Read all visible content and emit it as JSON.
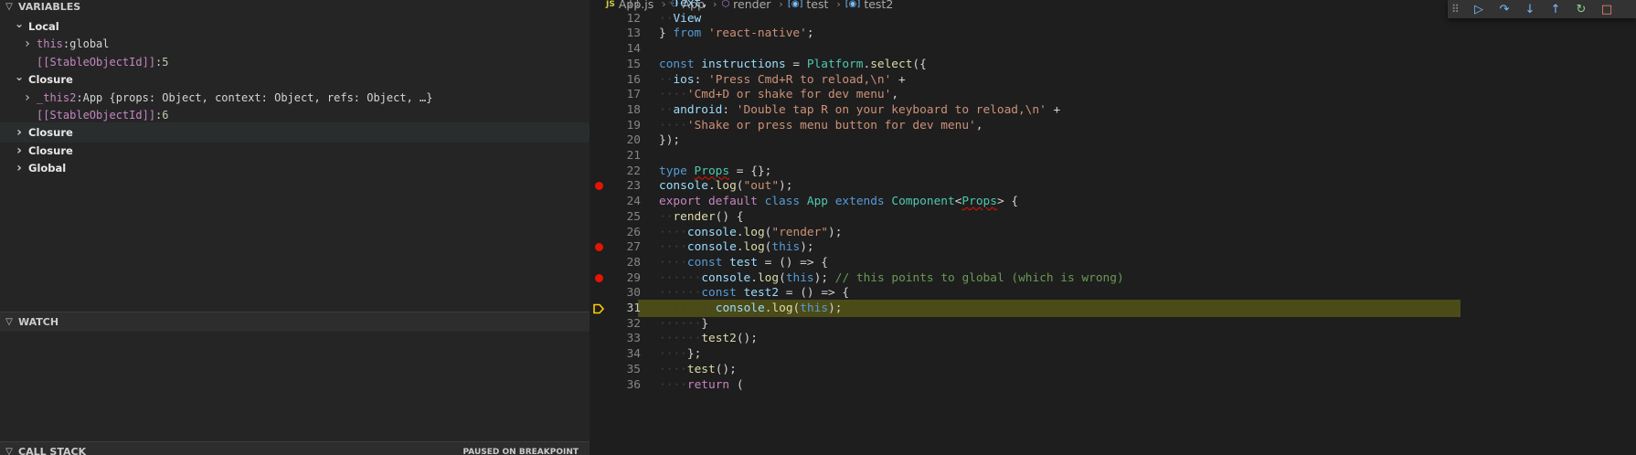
{
  "sidebar": {
    "variables_header": "VARIABLES",
    "rows": [
      {
        "kind": "scope",
        "label": "Local",
        "expanded": true
      },
      {
        "kind": "var",
        "expandable": true,
        "name": "this",
        "value": "global"
      },
      {
        "kind": "var",
        "expandable": false,
        "name": "[[StableObjectId]]",
        "value": "5"
      },
      {
        "kind": "scope",
        "label": "Closure",
        "expanded": true
      },
      {
        "kind": "var",
        "expandable": true,
        "name": "_this2",
        "value": "App {props: Object, context: Object, refs: Object, …}"
      },
      {
        "kind": "var",
        "expandable": false,
        "name": "[[StableObjectId]]",
        "value": "6"
      },
      {
        "kind": "scope",
        "label": "Closure",
        "expanded": false,
        "hover": true
      },
      {
        "kind": "scope",
        "label": "Closure",
        "expanded": false
      },
      {
        "kind": "scope",
        "label": "Global",
        "expanded": false
      }
    ],
    "watch_header": "WATCH",
    "callstack_header": "CALL STACK",
    "callstack_status": "PAUSED ON BREAKPOINT"
  },
  "breadcrumb": [
    {
      "icon": "js-file-icon",
      "glyph": "JS",
      "label": "App.js"
    },
    {
      "icon": "class-icon",
      "glyph": "⚇",
      "label": "App"
    },
    {
      "icon": "method-icon",
      "glyph": "⬡",
      "label": "render"
    },
    {
      "icon": "variable-icon",
      "glyph": "[◉]",
      "label": "test"
    },
    {
      "icon": "variable-icon",
      "glyph": "[◉]",
      "label": "test2"
    }
  ],
  "debug_toolbar": [
    {
      "name": "continue-button",
      "glyph": "▷",
      "color": "#75beff"
    },
    {
      "name": "step-over-button",
      "glyph": "↷",
      "color": "#75beff"
    },
    {
      "name": "step-into-button",
      "glyph": "↓",
      "color": "#75beff"
    },
    {
      "name": "step-out-button",
      "glyph": "↑",
      "color": "#75beff"
    },
    {
      "name": "restart-button",
      "glyph": "↻",
      "color": "#89d185"
    },
    {
      "name": "stop-button",
      "glyph": "□",
      "color": "#f48771"
    }
  ],
  "code": {
    "first_line": 11,
    "current_line": 31,
    "breakpoints": [
      23,
      27,
      29
    ],
    "lines": [
      "  Text,",
      "  View",
      "} from 'react-native';",
      "",
      "const instructions = Platform.select({",
      "  ios: 'Press Cmd+R to reload,\\n' +",
      "    'Cmd+D or shake for dev menu',",
      "  android: 'Double tap R on your keyboard to reload,\\n' +",
      "    'Shake or press menu button for dev menu',",
      "});",
      "",
      "type Props = {};",
      "console.log(\"out\");",
      "export default class App extends Component<Props> {",
      "  render() {",
      "    console.log(\"render\");",
      "    console.log(this);",
      "    const test = () => {",
      "      console.log(this); // this points to global (which is wrong)",
      "      const test2 = () => {",
      "        console.log(this);",
      "      }",
      "      test2();",
      "    };",
      "    test();",
      "    return ("
    ]
  },
  "colors": {
    "breakpoint": "#e51400",
    "current_line_bg": "#4b4b18",
    "current_marker": "#ffcc00"
  }
}
